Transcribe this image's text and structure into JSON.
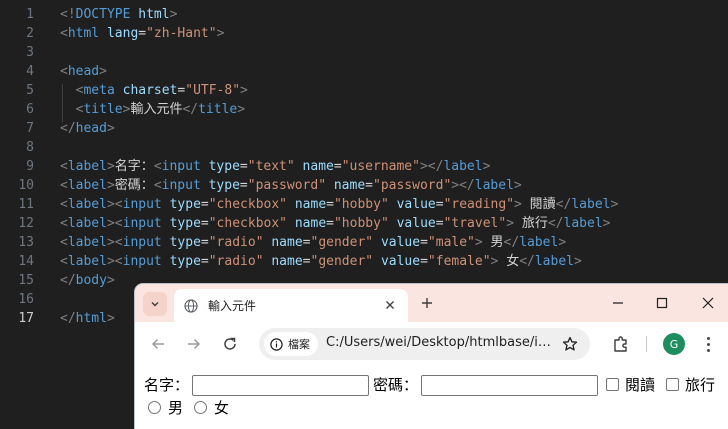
{
  "editor": {
    "active_line": 17,
    "lines": [
      {
        "num": "1",
        "tokens": [
          [
            "br",
            "<!"
          ],
          [
            "tag",
            "DOCTYPE"
          ],
          [
            "txt",
            " "
          ],
          [
            "attr",
            "html"
          ],
          [
            "br",
            ">"
          ]
        ]
      },
      {
        "num": "2",
        "tokens": [
          [
            "br",
            "<"
          ],
          [
            "tag",
            "html"
          ],
          [
            "txt",
            " "
          ],
          [
            "attr",
            "lang"
          ],
          [
            "txt",
            "="
          ],
          [
            "val",
            "\"zh-Hant\""
          ],
          [
            "br",
            ">"
          ]
        ]
      },
      {
        "num": "3",
        "tokens": []
      },
      {
        "num": "4",
        "tokens": [
          [
            "br",
            "<"
          ],
          [
            "tag",
            "head"
          ],
          [
            "br",
            ">"
          ]
        ]
      },
      {
        "num": "5",
        "tokens": [
          [
            "txt",
            "  "
          ],
          [
            "br",
            "<"
          ],
          [
            "tag",
            "meta"
          ],
          [
            "txt",
            " "
          ],
          [
            "attr",
            "charset"
          ],
          [
            "txt",
            "="
          ],
          [
            "val",
            "\"UTF-8\""
          ],
          [
            "br",
            ">"
          ]
        ]
      },
      {
        "num": "6",
        "tokens": [
          [
            "txt",
            "  "
          ],
          [
            "br",
            "<"
          ],
          [
            "tag",
            "title"
          ],
          [
            "br",
            ">"
          ],
          [
            "txt",
            "輸入元件"
          ],
          [
            "br",
            "</"
          ],
          [
            "tag",
            "title"
          ],
          [
            "br",
            ">"
          ]
        ]
      },
      {
        "num": "7",
        "tokens": [
          [
            "br",
            "</"
          ],
          [
            "tag",
            "head"
          ],
          [
            "br",
            ">"
          ]
        ]
      },
      {
        "num": "8",
        "tokens": []
      },
      {
        "num": "9",
        "tokens": [
          [
            "br",
            "<"
          ],
          [
            "tag",
            "label"
          ],
          [
            "br",
            ">"
          ],
          [
            "txt",
            "名字："
          ],
          [
            "br",
            "<"
          ],
          [
            "tag",
            "input"
          ],
          [
            "txt",
            " "
          ],
          [
            "attr",
            "type"
          ],
          [
            "txt",
            "="
          ],
          [
            "val",
            "\"text\""
          ],
          [
            "txt",
            " "
          ],
          [
            "attr",
            "name"
          ],
          [
            "txt",
            "="
          ],
          [
            "val",
            "\"username\""
          ],
          [
            "br",
            ">"
          ],
          [
            "br",
            "</"
          ],
          [
            "tag",
            "label"
          ],
          [
            "br",
            ">"
          ]
        ]
      },
      {
        "num": "10",
        "tokens": [
          [
            "br",
            "<"
          ],
          [
            "tag",
            "label"
          ],
          [
            "br",
            ">"
          ],
          [
            "txt",
            "密碼："
          ],
          [
            "br",
            "<"
          ],
          [
            "tag",
            "input"
          ],
          [
            "txt",
            " "
          ],
          [
            "attr",
            "type"
          ],
          [
            "txt",
            "="
          ],
          [
            "val",
            "\"password\""
          ],
          [
            "txt",
            " "
          ],
          [
            "attr",
            "name"
          ],
          [
            "txt",
            "="
          ],
          [
            "val",
            "\"password\""
          ],
          [
            "br",
            ">"
          ],
          [
            "br",
            "</"
          ],
          [
            "tag",
            "label"
          ],
          [
            "br",
            ">"
          ]
        ]
      },
      {
        "num": "11",
        "tokens": [
          [
            "br",
            "<"
          ],
          [
            "tag",
            "label"
          ],
          [
            "br",
            "><"
          ],
          [
            "tag",
            "input"
          ],
          [
            "txt",
            " "
          ],
          [
            "attr",
            "type"
          ],
          [
            "txt",
            "="
          ],
          [
            "val",
            "\"checkbox\""
          ],
          [
            "txt",
            " "
          ],
          [
            "attr",
            "name"
          ],
          [
            "txt",
            "="
          ],
          [
            "val",
            "\"hobby\""
          ],
          [
            "txt",
            " "
          ],
          [
            "attr",
            "value"
          ],
          [
            "txt",
            "="
          ],
          [
            "val",
            "\"reading\""
          ],
          [
            "br",
            ">"
          ],
          [
            "txt",
            " 閱讀"
          ],
          [
            "br",
            "</"
          ],
          [
            "tag",
            "label"
          ],
          [
            "br",
            ">"
          ]
        ]
      },
      {
        "num": "12",
        "tokens": [
          [
            "br",
            "<"
          ],
          [
            "tag",
            "label"
          ],
          [
            "br",
            "><"
          ],
          [
            "tag",
            "input"
          ],
          [
            "txt",
            " "
          ],
          [
            "attr",
            "type"
          ],
          [
            "txt",
            "="
          ],
          [
            "val",
            "\"checkbox\""
          ],
          [
            "txt",
            " "
          ],
          [
            "attr",
            "name"
          ],
          [
            "txt",
            "="
          ],
          [
            "val",
            "\"hobby\""
          ],
          [
            "txt",
            " "
          ],
          [
            "attr",
            "value"
          ],
          [
            "txt",
            "="
          ],
          [
            "val",
            "\"travel\""
          ],
          [
            "br",
            ">"
          ],
          [
            "txt",
            " 旅行"
          ],
          [
            "br",
            "</"
          ],
          [
            "tag",
            "label"
          ],
          [
            "br",
            ">"
          ]
        ]
      },
      {
        "num": "13",
        "tokens": [
          [
            "br",
            "<"
          ],
          [
            "tag",
            "label"
          ],
          [
            "br",
            "><"
          ],
          [
            "tag",
            "input"
          ],
          [
            "txt",
            " "
          ],
          [
            "attr",
            "type"
          ],
          [
            "txt",
            "="
          ],
          [
            "val",
            "\"radio\""
          ],
          [
            "txt",
            " "
          ],
          [
            "attr",
            "name"
          ],
          [
            "txt",
            "="
          ],
          [
            "val",
            "\"gender\""
          ],
          [
            "txt",
            " "
          ],
          [
            "attr",
            "value"
          ],
          [
            "txt",
            "="
          ],
          [
            "val",
            "\"male\""
          ],
          [
            "br",
            ">"
          ],
          [
            "txt",
            " 男"
          ],
          [
            "br",
            "</"
          ],
          [
            "tag",
            "label"
          ],
          [
            "br",
            ">"
          ]
        ]
      },
      {
        "num": "14",
        "tokens": [
          [
            "br",
            "<"
          ],
          [
            "tag",
            "label"
          ],
          [
            "br",
            "><"
          ],
          [
            "tag",
            "input"
          ],
          [
            "txt",
            " "
          ],
          [
            "attr",
            "type"
          ],
          [
            "txt",
            "="
          ],
          [
            "val",
            "\"radio\""
          ],
          [
            "txt",
            " "
          ],
          [
            "attr",
            "name"
          ],
          [
            "txt",
            "="
          ],
          [
            "val",
            "\"gender\""
          ],
          [
            "txt",
            " "
          ],
          [
            "attr",
            "value"
          ],
          [
            "txt",
            "="
          ],
          [
            "val",
            "\"female\""
          ],
          [
            "br",
            ">"
          ],
          [
            "txt",
            " 女"
          ],
          [
            "br",
            "</"
          ],
          [
            "tag",
            "label"
          ],
          [
            "br",
            ">"
          ]
        ]
      },
      {
        "num": "15",
        "tokens": [
          [
            "br",
            "</"
          ],
          [
            "tag",
            "body"
          ],
          [
            "br",
            ">"
          ]
        ]
      },
      {
        "num": "16",
        "tokens": []
      },
      {
        "num": "17",
        "tokens": [
          [
            "br",
            "</"
          ],
          [
            "tag",
            "html"
          ],
          [
            "br",
            ">"
          ]
        ]
      }
    ]
  },
  "browser": {
    "tab_title": "輸入元件",
    "site_info_label": "檔案",
    "url": "C:/Users/wei/Desktop/htmlbase/index.html",
    "profile_initial": "G",
    "icons": {
      "tab_search": "chevron-down-icon",
      "tab_favicon": "globe-icon",
      "tab_close": "close-icon",
      "new_tab": "plus-icon",
      "minimize": "minimize-icon",
      "maximize": "maximize-icon",
      "close_window": "close-icon",
      "back": "arrow-left-icon",
      "forward": "arrow-right-icon",
      "reload": "reload-icon",
      "site_info": "info-icon",
      "bookmark": "star-icon",
      "extensions": "puzzle-icon",
      "menu": "more-vertical-icon"
    },
    "colors": {
      "tab_strip": "#fbe5e0",
      "avatar": "#1e8e5e"
    }
  },
  "page": {
    "username_label": "名字：",
    "username_value": "",
    "password_label": "密碼：",
    "password_value": "",
    "hobby_reading_label": "閱讀",
    "hobby_reading_checked": false,
    "hobby_travel_label": "旅行",
    "hobby_travel_checked": false,
    "gender_male_label": "男",
    "gender_male_checked": false,
    "gender_female_label": "女",
    "gender_female_checked": false
  }
}
